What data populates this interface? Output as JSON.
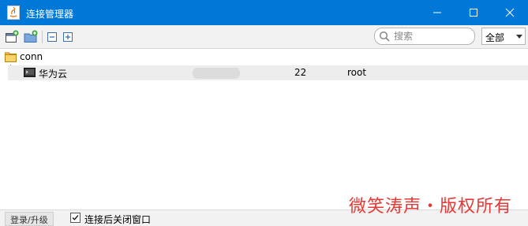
{
  "window": {
    "title": "连接管理器"
  },
  "toolbar": {
    "search_placeholder": "搜索",
    "filter": {
      "selected": "全部"
    }
  },
  "tree": {
    "folder_label": "conn",
    "connections": [
      {
        "name": "华为云",
        "port": "22",
        "user": "root"
      }
    ]
  },
  "statusbar": {
    "login_label": "登录/升级",
    "close_after_connect_label": "连接后关闭窗口",
    "close_after_connect_checked": true
  },
  "watermark": "微笑涛声・版权所有",
  "colors": {
    "titlebar": "#0078d7",
    "watermark": "#e53935",
    "row_selected": "#ededed"
  }
}
